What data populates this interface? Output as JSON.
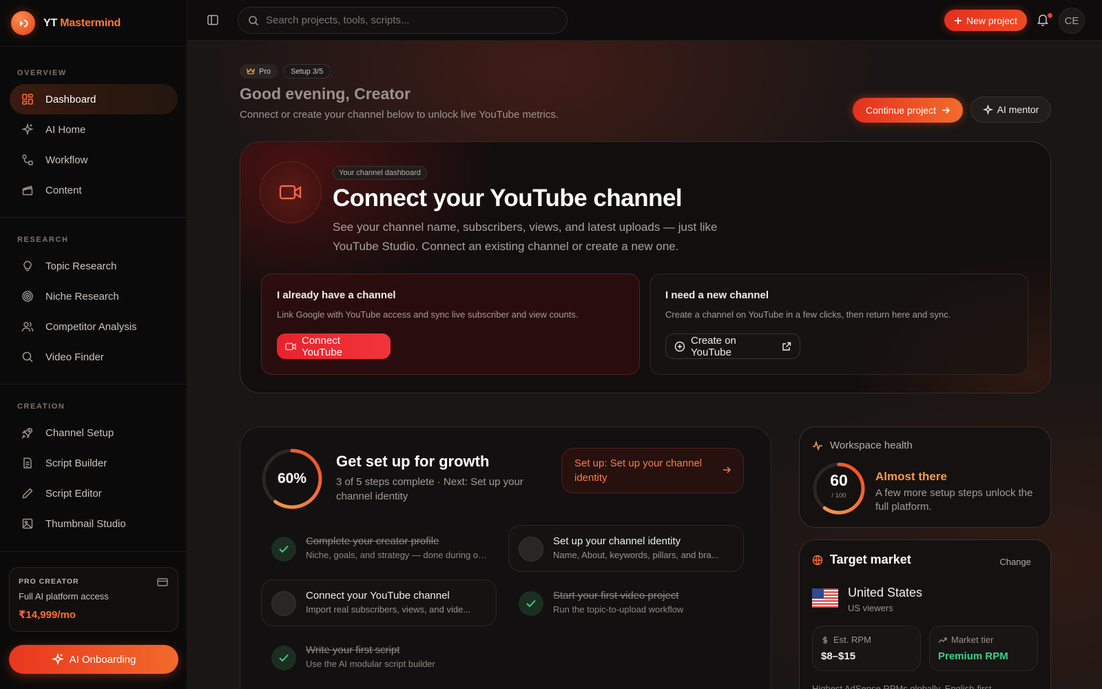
{
  "brand": {
    "name_part1": "YT",
    "name_part2": "Mastermind"
  },
  "sidebar": {
    "sections": [
      {
        "label": "OVERVIEW",
        "items": [
          {
            "label": "Dashboard",
            "icon": "grid-icon",
            "active": true
          },
          {
            "label": "AI Home",
            "icon": "sparkles-icon"
          },
          {
            "label": "Workflow",
            "icon": "workflow-icon"
          },
          {
            "label": "Content",
            "icon": "clapperboard-icon"
          }
        ]
      },
      {
        "label": "RESEARCH",
        "items": [
          {
            "label": "Topic Research",
            "icon": "lightbulb-icon"
          },
          {
            "label": "Niche Research",
            "icon": "target-icon"
          },
          {
            "label": "Competitor Analysis",
            "icon": "users-icon"
          },
          {
            "label": "Video Finder",
            "icon": "search-icon"
          }
        ]
      },
      {
        "label": "CREATION",
        "items": [
          {
            "label": "Channel Setup",
            "icon": "rocket-icon"
          },
          {
            "label": "Script Builder",
            "icon": "document-icon"
          },
          {
            "label": "Script Editor",
            "icon": "pen-icon"
          },
          {
            "label": "Thumbnail Studio",
            "icon": "image-icon"
          }
        ]
      }
    ],
    "plan": {
      "title": "PRO CREATOR",
      "desc": "Full AI platform access",
      "price": "₹14,999/mo"
    },
    "onboarding_label": "AI Onboarding"
  },
  "topbar": {
    "search_placeholder": "Search projects, tools, scripts...",
    "new_project_label": "New project",
    "avatar_initials": "CE"
  },
  "header": {
    "badge_pro": "Pro",
    "badge_setup": "Setup 3/5",
    "greeting": "Good evening, Creator",
    "subtitle": "Connect or create your channel below to unlock live YouTube metrics.",
    "continue_label": "Continue project",
    "mentor_label": "AI mentor"
  },
  "hero": {
    "tag": "Your channel dashboard",
    "title": "Connect your YouTube channel",
    "desc": "See your channel name, subscribers, views, and latest uploads — just like YouTube Studio. Connect an existing channel or create a new one.",
    "have": {
      "title": "I already have a channel",
      "desc": "Link Google with YouTube access and sync live subscriber and view counts.",
      "button": "Connect YouTube"
    },
    "need": {
      "title": "I need a new channel",
      "desc": "Create a channel on YouTube in a few clicks, then return here and sync.",
      "button": "Create on YouTube"
    }
  },
  "growth": {
    "percent": 60,
    "percent_label": "60%",
    "title": "Get set up for growth",
    "subtitle": "3 of 5 steps complete · Next: Set up your channel identity",
    "cta": "Set up: Set up your channel identity",
    "steps": [
      {
        "title": "Complete your creator profile",
        "desc": "Niche, goals, and strategy — done during on...",
        "done": true
      },
      {
        "title": "Set up your channel identity",
        "desc": "Name, About, keywords, pillars, and bra...",
        "done": false
      },
      {
        "title": "Connect your YouTube channel",
        "desc": "Import real subscribers, views, and vide...",
        "done": false
      },
      {
        "title": "Start your first video project",
        "desc": "Run the topic-to-upload workflow",
        "done": true
      },
      {
        "title": "Write your first script",
        "desc": "Use the AI modular script builder",
        "done": true
      }
    ]
  },
  "health": {
    "title": "Workspace health",
    "score": "60",
    "score_value": 60,
    "max_label": "/ 100",
    "status": "Almost there",
    "desc": "A few more setup steps unlock the full platform."
  },
  "market": {
    "title": "Target market",
    "change_label": "Change",
    "country": "United States",
    "viewers": "US viewers",
    "rpm_label": "Est. RPM",
    "rpm_value": "$8–$15",
    "tier_label": "Market tier",
    "tier_value": "Premium RPM",
    "footnote": "Highest AdSense RPMs globally. English-first"
  },
  "colors": {
    "accent": "#ff6b3a",
    "danger": "#e8222d",
    "success": "#3ecf8e",
    "warning": "#f59a4e"
  }
}
